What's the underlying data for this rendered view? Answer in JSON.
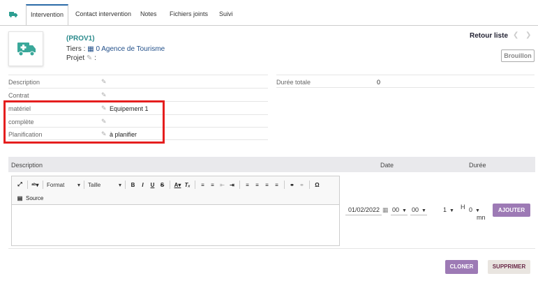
{
  "tabs": [
    {
      "label": "Intervention",
      "active": true
    },
    {
      "label": "Contact intervention"
    },
    {
      "label": "Notes"
    },
    {
      "label": "Fichiers joints"
    },
    {
      "label": "Suivi"
    }
  ],
  "header": {
    "ref": "(PROV1)",
    "tiers_label": "Tiers :",
    "tiers_value": "0 Agence de Tourisme",
    "projet_label": "Projet",
    "projet_suffix": ":",
    "retour_liste": "Retour liste",
    "status": "Brouillon"
  },
  "fields_left": [
    {
      "label": "Description",
      "value": ""
    },
    {
      "label": "Contrat",
      "value": ""
    },
    {
      "label": "matériel",
      "value": "Equipement 1"
    },
    {
      "label": "complète",
      "value": ""
    },
    {
      "label": "Planification",
      "value": "à planifier"
    }
  ],
  "fields_right": [
    {
      "label": "Durée totale",
      "value": "0"
    }
  ],
  "lines_table": {
    "col_description": "Description",
    "col_date": "Date",
    "col_duree": "Durée"
  },
  "editor": {
    "format_label": "Format",
    "size_label": "Taille",
    "source_label": "Source"
  },
  "new_line": {
    "date": "01/02/2022",
    "hour": "00",
    "minute": "00",
    "duration_hours": "1",
    "h_label": "H",
    "duration_minutes": "0",
    "mn_label": "mn",
    "add_button": "AJOUTER"
  },
  "actions": {
    "clone": "CLONER",
    "delete": "SUPPRIMER"
  },
  "colors": {
    "accent_teal": "#2d9e91",
    "purple_button": "#9d7ab5",
    "highlight_red": "#e51e1e"
  }
}
